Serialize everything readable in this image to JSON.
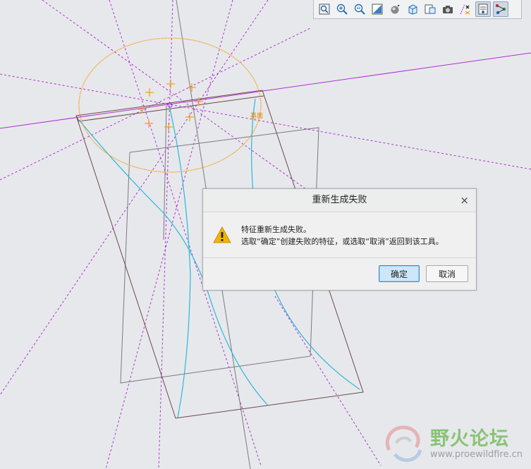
{
  "toolbar": {
    "buttons": [
      {
        "icon": "zoom-fit-icon"
      },
      {
        "icon": "zoom-in-icon"
      },
      {
        "icon": "zoom-out-icon"
      },
      {
        "icon": "repaint-icon"
      },
      {
        "icon": "display-style-icon"
      },
      {
        "icon": "saved-orientation-icon"
      },
      {
        "icon": "view-manager-icon"
      },
      {
        "icon": "perspective-view-icon"
      },
      {
        "icon": "datum-display-filter-icon"
      },
      {
        "icon": "annotation-display-icon",
        "active": true
      },
      {
        "icon": "spin-center-icon",
        "active": true
      }
    ]
  },
  "canvas": {
    "sketch_label": "基面",
    "colors": {
      "background": "#e7e8ec",
      "datum_axis": "#b030d0",
      "sketch": "#f0a020",
      "curve": "#2ab8d8",
      "edge": "#6b4a4a",
      "reference": "#7a7a80"
    }
  },
  "dialog": {
    "title": "重新生成失败",
    "close_symbol": "×",
    "message_line1": "特征重新生成失败。",
    "message_line2": "选取“确定”创建失败的特征，或选取“取消”返回到该工具。",
    "ok_label": "确定",
    "cancel_label": "取消",
    "warning_color": "#f2b400"
  },
  "watermark": {
    "title": "野火论坛",
    "url": "www.proewildfire.cn"
  }
}
